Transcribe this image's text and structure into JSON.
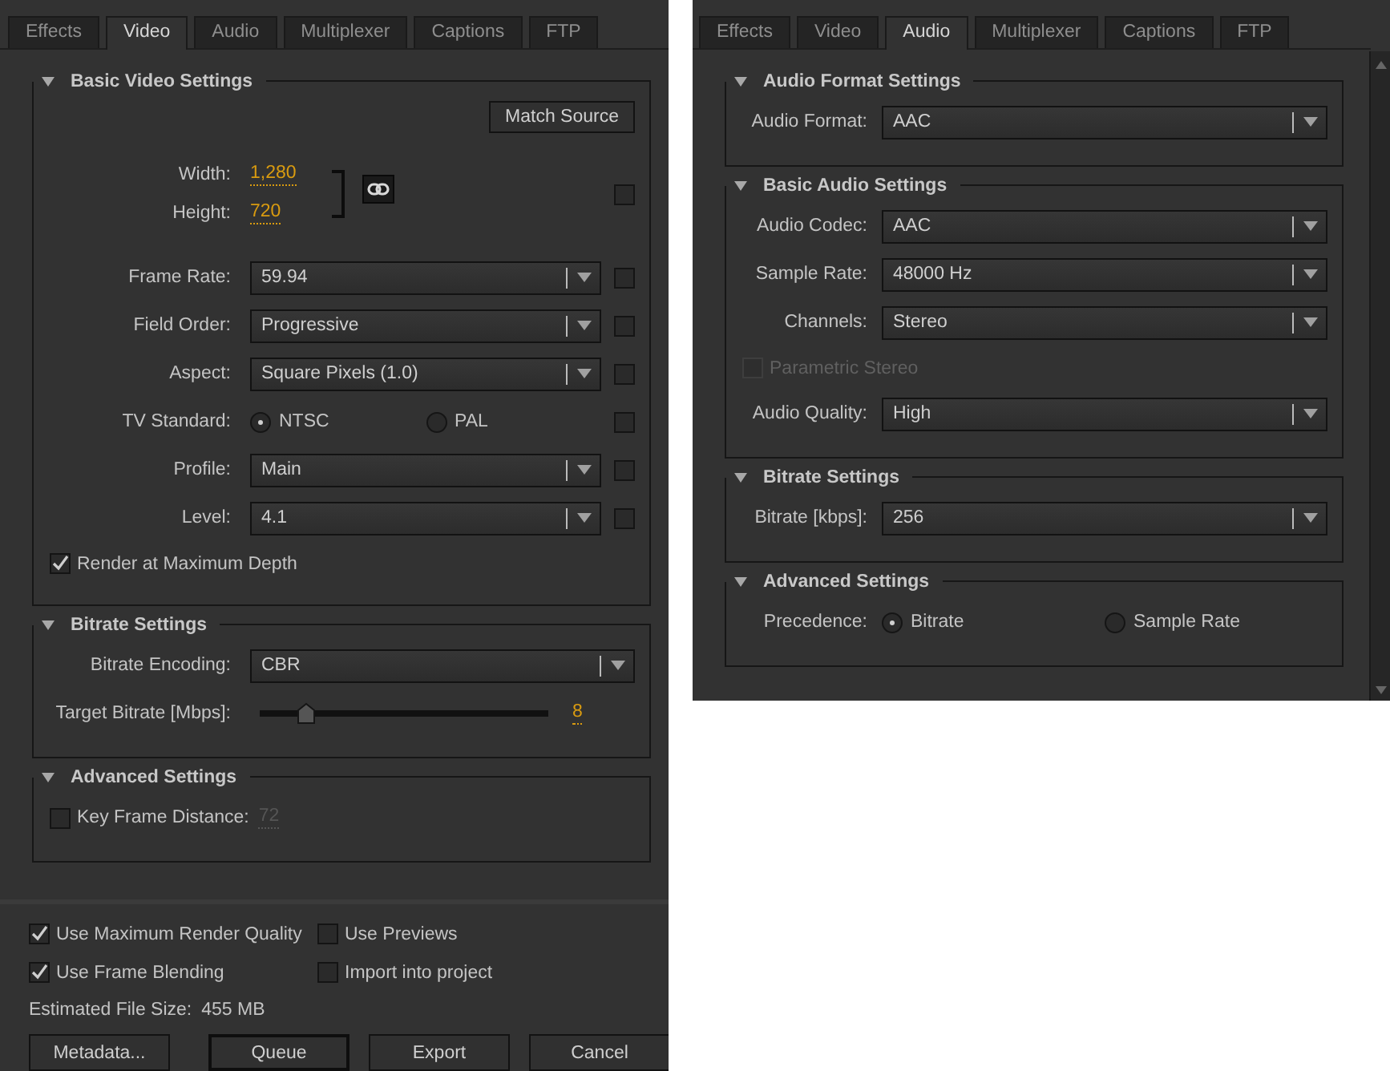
{
  "panels": [
    {
      "tabs": [
        {
          "label": "Effects",
          "selected": false
        },
        {
          "label": "Video",
          "selected": true
        },
        {
          "label": "Audio",
          "selected": false
        },
        {
          "label": "Multiplexer",
          "selected": false
        },
        {
          "label": "Captions",
          "selected": false
        },
        {
          "label": "FTP",
          "selected": false
        }
      ],
      "sections": [
        {
          "title": "Basic Video Settings",
          "expanded": true,
          "rows": [
            {
              "kind": "button",
              "label": "Match Source"
            },
            {
              "kind": "dimensions",
              "fields": [
                {
                  "label": "Width:",
                  "value": "1,280"
                },
                {
                  "label": "Height:",
                  "value": "720"
                }
              ],
              "side_checkbox": {
                "checked": false
              }
            },
            {
              "kind": "select",
              "label": "Frame Rate:",
              "value": "59.94",
              "side_checkbox": {
                "checked": false
              }
            },
            {
              "kind": "select",
              "label": "Field Order:",
              "value": "Progressive",
              "side_checkbox": {
                "checked": false
              }
            },
            {
              "kind": "select",
              "label": "Aspect:",
              "value": "Square Pixels (1.0)",
              "side_checkbox": {
                "checked": false
              }
            },
            {
              "kind": "radio",
              "label": "TV Standard:",
              "options": [
                {
                  "label": "NTSC",
                  "selected": true
                },
                {
                  "label": "PAL",
                  "selected": false
                }
              ],
              "side_checkbox": {
                "checked": false
              }
            },
            {
              "kind": "select",
              "label": "Profile:",
              "value": "Main",
              "side_checkbox": {
                "checked": false
              }
            },
            {
              "kind": "select",
              "label": "Level:",
              "value": "4.1",
              "side_checkbox": {
                "checked": false
              }
            },
            {
              "kind": "checkbox",
              "label": "Render at Maximum Depth",
              "checked": true,
              "disabled": false
            }
          ]
        },
        {
          "title": "Bitrate Settings",
          "expanded": true,
          "rows": [
            {
              "kind": "select",
              "label": "Bitrate Encoding:",
              "value": "CBR"
            },
            {
              "kind": "slider",
              "label": "Target Bitrate [Mbps]:",
              "level": 0.15,
              "reading": "8"
            }
          ]
        },
        {
          "title": "Advanced Settings",
          "expanded": true,
          "rows": [
            {
              "kind": "checkbox_value",
              "label": "Key Frame Distance:",
              "checked": false,
              "value": "72"
            }
          ]
        }
      ],
      "footer": {
        "options": [
          {
            "label": "Use Maximum Render Quality",
            "checked": true
          },
          {
            "label": "Use Previews",
            "checked": false
          },
          {
            "label": "Use Frame Blending",
            "checked": true
          },
          {
            "label": "Import into project",
            "checked": false
          }
        ],
        "estimate": {
          "label": "Estimated File Size:",
          "value": "455 MB"
        },
        "buttons": [
          {
            "label": "Metadata...",
            "default": false
          },
          {
            "label": "Queue",
            "default": true
          },
          {
            "label": "Export",
            "default": false
          },
          {
            "label": "Cancel",
            "default": false
          }
        ]
      }
    },
    {
      "tabs": [
        {
          "label": "Effects",
          "selected": false
        },
        {
          "label": "Video",
          "selected": false
        },
        {
          "label": "Audio",
          "selected": true
        },
        {
          "label": "Multiplexer",
          "selected": false
        },
        {
          "label": "Captions",
          "selected": false
        },
        {
          "label": "FTP",
          "selected": false
        }
      ],
      "scrollbar": true,
      "sections": [
        {
          "title": "Audio Format Settings",
          "expanded": true,
          "rows": [
            {
              "kind": "select",
              "label": "Audio Format:",
              "value": "AAC"
            }
          ]
        },
        {
          "title": "Basic Audio Settings",
          "expanded": true,
          "rows": [
            {
              "kind": "select",
              "label": "Audio Codec:",
              "value": "AAC"
            },
            {
              "kind": "select",
              "label": "Sample Rate:",
              "value": "48000 Hz"
            },
            {
              "kind": "select",
              "label": "Channels:",
              "value": "Stereo"
            },
            {
              "kind": "checkbox",
              "label": "Parametric Stereo",
              "checked": false,
              "disabled": true
            },
            {
              "kind": "select",
              "label": "Audio Quality:",
              "value": "High"
            }
          ]
        },
        {
          "title": "Bitrate Settings",
          "expanded": true,
          "rows": [
            {
              "kind": "select",
              "label": "Bitrate [kbps]:",
              "value": "256"
            }
          ]
        },
        {
          "title": "Advanced Settings",
          "expanded": true,
          "rows": [
            {
              "kind": "radio",
              "label": "Precedence:",
              "options": [
                {
                  "label": "Bitrate",
                  "selected": true
                },
                {
                  "label": "Sample Rate",
                  "selected": false
                }
              ]
            }
          ]
        }
      ]
    }
  ]
}
